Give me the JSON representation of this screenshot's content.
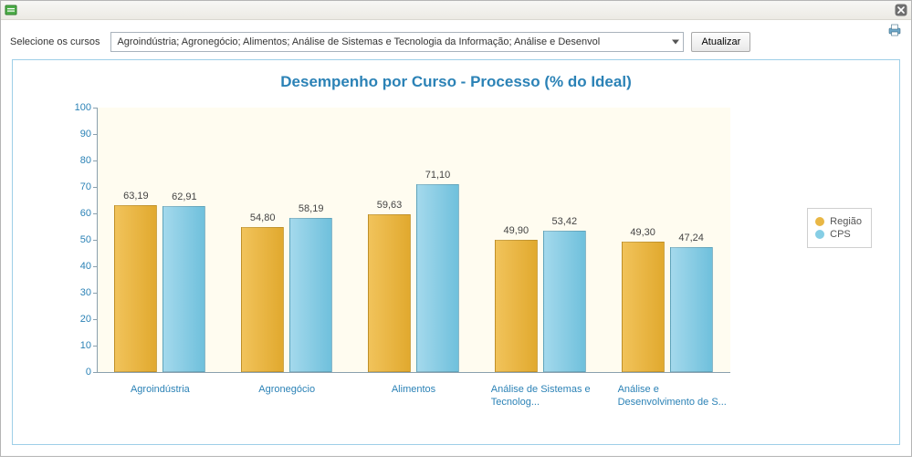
{
  "toolbar": {
    "label": "Selecione os cursos",
    "select_value": "Agroindústria; Agronegócio; Alimentos; Análise de Sistemas e Tecnologia da Informação; Análise e Desenvol",
    "update_label": "Atualizar"
  },
  "legend": {
    "items": [
      {
        "key": "regiao",
        "label": "Região",
        "color": "#e9b745"
      },
      {
        "key": "cps",
        "label": "CPS",
        "color": "#86cee5"
      }
    ]
  },
  "chart_data": {
    "type": "bar",
    "title": "Desempenho por Curso - Processo (% do Ideal)",
    "xlabel": "",
    "ylabel": "",
    "ylim": [
      0,
      100
    ],
    "y_ticks": [
      0,
      10,
      20,
      30,
      40,
      50,
      60,
      70,
      80,
      90,
      100
    ],
    "categories": [
      "Agroindústria",
      "Agronegócio",
      "Alimentos",
      "Análise de Sistemas e Tecnolog...",
      "Análise e Desenvolvimento de S..."
    ],
    "series": [
      {
        "name": "Região",
        "values": [
          63.19,
          54.8,
          59.63,
          49.9,
          49.3
        ]
      },
      {
        "name": "CPS",
        "values": [
          62.91,
          58.19,
          71.1,
          53.42,
          47.24
        ]
      }
    ],
    "value_labels": [
      [
        "63,19",
        "62,91"
      ],
      [
        "54,80",
        "58,19"
      ],
      [
        "59,63",
        "71,10"
      ],
      [
        "49,90",
        "53,42"
      ],
      [
        "49,30",
        "47,24"
      ]
    ]
  }
}
